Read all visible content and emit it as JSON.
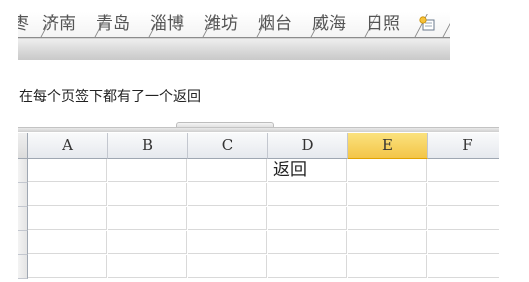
{
  "sheet_tabs": {
    "partial_first": "枣",
    "tabs": [
      "济南",
      "青岛",
      "淄博",
      "潍坊",
      "烟台",
      "威海",
      "日照"
    ],
    "insert_icon": "insert-worksheet-icon"
  },
  "caption": "在每个页签下都有了一个返回",
  "spreadsheet": {
    "columns": [
      "A",
      "B",
      "C",
      "D",
      "E",
      "F"
    ],
    "active_column": "E",
    "cells": [
      {
        "row": 1,
        "col": "D",
        "value": "返回"
      }
    ]
  }
}
